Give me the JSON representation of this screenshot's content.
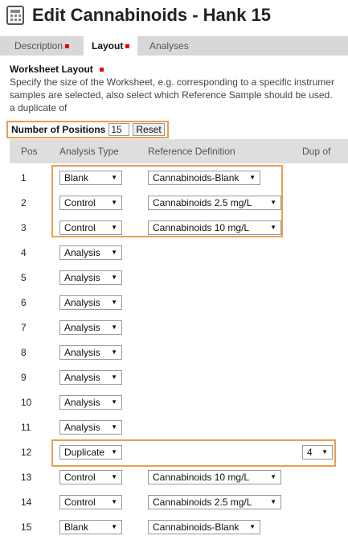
{
  "page": {
    "title": "Edit Cannabinoids - Hank 15"
  },
  "tabs": [
    {
      "label": "Description",
      "required": true
    },
    {
      "label": "Layout",
      "required": true,
      "active": true
    },
    {
      "label": "Analyses",
      "required": false
    }
  ],
  "section": {
    "title": "Worksheet Layout",
    "description": [
      "Specify the size of the Worksheet, e.g. corresponding to a specific instrumer",
      "samples are selected, also select which Reference Sample should be used.",
      "a duplicate of"
    ]
  },
  "positions_control": {
    "label": "Number of Positions",
    "value": "15",
    "reset_label": "Reset"
  },
  "table": {
    "headers": [
      "Pos",
      "Analysis Type",
      "Reference Definition",
      "Dup of"
    ],
    "rows": [
      {
        "pos": "1",
        "type": "Blank",
        "ref": "Cannabinoids-Blank",
        "dup": ""
      },
      {
        "pos": "2",
        "type": "Control",
        "ref": "Cannabinoids 2.5 mg/L",
        "dup": ""
      },
      {
        "pos": "3",
        "type": "Control",
        "ref": "Cannabinoids 10 mg/L",
        "dup": ""
      },
      {
        "pos": "4",
        "type": "Analysis",
        "ref": "",
        "dup": ""
      },
      {
        "pos": "5",
        "type": "Analysis",
        "ref": "",
        "dup": ""
      },
      {
        "pos": "6",
        "type": "Analysis",
        "ref": "",
        "dup": ""
      },
      {
        "pos": "7",
        "type": "Analysis",
        "ref": "",
        "dup": ""
      },
      {
        "pos": "8",
        "type": "Analysis",
        "ref": "",
        "dup": ""
      },
      {
        "pos": "9",
        "type": "Analysis",
        "ref": "",
        "dup": ""
      },
      {
        "pos": "10",
        "type": "Analysis",
        "ref": "",
        "dup": ""
      },
      {
        "pos": "11",
        "type": "Analysis",
        "ref": "",
        "dup": ""
      },
      {
        "pos": "12",
        "type": "Duplicate",
        "ref": "",
        "dup": "4"
      },
      {
        "pos": "13",
        "type": "Control",
        "ref": "Cannabinoids 10 mg/L",
        "dup": ""
      },
      {
        "pos": "14",
        "type": "Control",
        "ref": "Cannabinoids 2.5 mg/L",
        "dup": ""
      },
      {
        "pos": "15",
        "type": "Blank",
        "ref": "Cannabinoids-Blank",
        "dup": ""
      }
    ]
  },
  "icons": {
    "title": "worksheet-icon",
    "dropdown": "dropdown-arrow-icon"
  },
  "colors": {
    "highlight": "#e8a050",
    "required": "#ee0000",
    "tab_bar": "#d8d8d8",
    "table_header": "#dedede"
  }
}
